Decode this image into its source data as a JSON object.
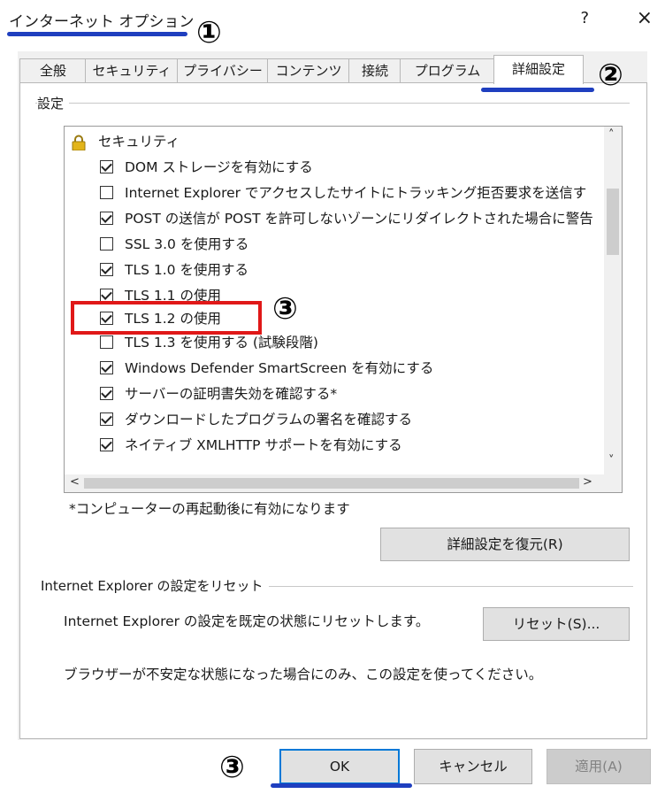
{
  "window": {
    "title": "インターネット オプション",
    "help_label": "?",
    "close_label": "×"
  },
  "annotations": {
    "one": "①",
    "two": "②",
    "three": "③",
    "highlight_color": "#e01818",
    "underline_color": "#1f3fbf"
  },
  "tabs": [
    {
      "label": "全般",
      "active": false
    },
    {
      "label": "セキュリティ",
      "active": false
    },
    {
      "label": "プライバシー",
      "active": false
    },
    {
      "label": "コンテンツ",
      "active": false
    },
    {
      "label": "接続",
      "active": false
    },
    {
      "label": "プログラム",
      "active": false
    },
    {
      "label": "詳細設定",
      "active": true
    }
  ],
  "settings": {
    "group_label": "設定",
    "category": "セキュリティ",
    "items": [
      {
        "label": "DOM ストレージを有効にする",
        "checked": true
      },
      {
        "label": "Internet Explorer でアクセスしたサイトにトラッキング拒否要求を送信す",
        "checked": false
      },
      {
        "label": "POST の送信が POST を許可しないゾーンにリダイレクトされた場合に警告",
        "checked": true
      },
      {
        "label": "SSL 3.0 を使用する",
        "checked": false
      },
      {
        "label": "TLS 1.0 を使用する",
        "checked": true
      },
      {
        "label": "TLS 1.1 の使用",
        "checked": true
      },
      {
        "label": "TLS 1.2 の使用",
        "checked": true
      },
      {
        "label": "TLS 1.3 を使用する (試験段階)",
        "checked": false
      },
      {
        "label": "Windows Defender SmartScreen を有効にする",
        "checked": true
      },
      {
        "label": "サーバーの証明書失効を確認する*",
        "checked": true
      },
      {
        "label": "ダウンロードしたプログラムの署名を確認する",
        "checked": true
      },
      {
        "label": "ネイティブ XMLHTTP サポートを有効にする",
        "checked": true
      }
    ],
    "restart_note": "*コンピューターの再起動後に有効になります",
    "restore_button": "詳細設定を復元(R)"
  },
  "reset": {
    "group_label": "Internet Explorer の設定をリセット",
    "description": "Internet Explorer の設定を既定の状態にリセットします。",
    "button": "リセット(S)...",
    "warning": "ブラウザーが不安定な状態になった場合にのみ、この設定を使ってください。"
  },
  "footer": {
    "ok": "OK",
    "cancel": "キャンセル",
    "apply": "適用(A)"
  }
}
